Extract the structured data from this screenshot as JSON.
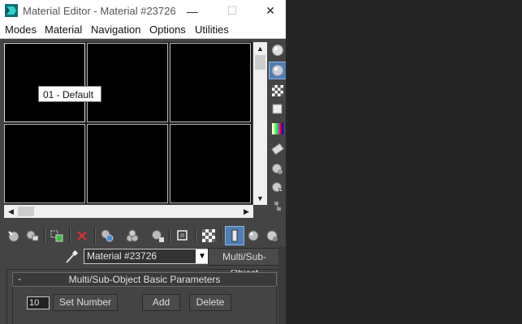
{
  "window": {
    "title": "Material Editor - Material #23726",
    "min_glyph": "—",
    "max_glyph": "☐",
    "close_glyph": "✕"
  },
  "menu": [
    "Modes",
    "Material",
    "Navigation",
    "Options",
    "Utilities"
  ],
  "viewport": {
    "slots": 6,
    "tooltip": "01 - Default"
  },
  "material": {
    "name": "Material #23726",
    "type_button": "Multi/Sub-Object"
  },
  "rollout": {
    "collapse_glyph": "-",
    "title": "Multi/Sub-Object Basic Parameters",
    "count_value": "10",
    "set_number_label": "Set Number",
    "add_label": "Add",
    "delete_label": "Delete"
  },
  "colors": {
    "panel": "#444444",
    "active_tool": "#4f7fb5",
    "delete_icon": "#e0302f"
  }
}
